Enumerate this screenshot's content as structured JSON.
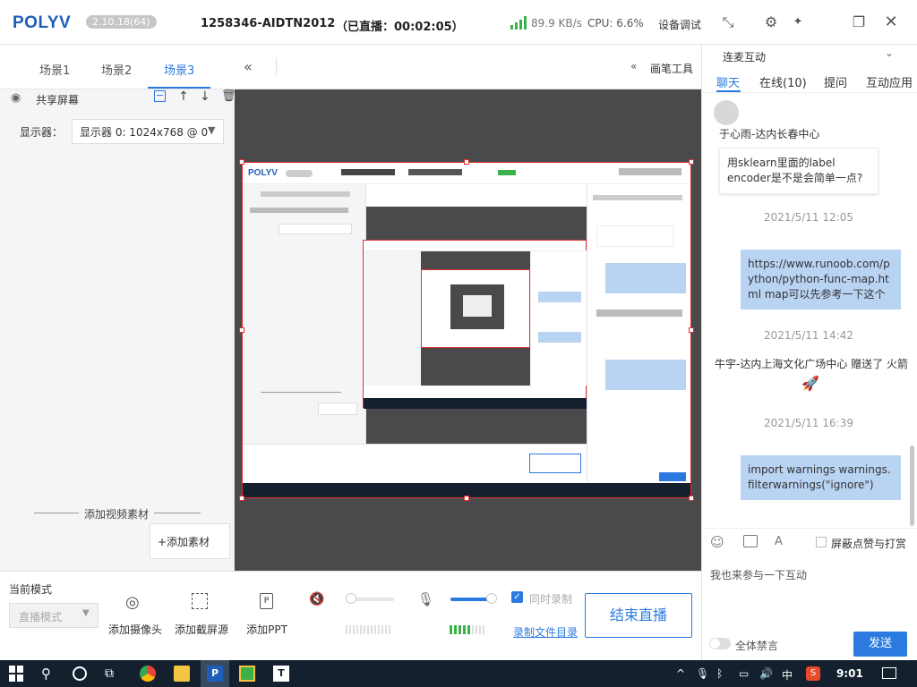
{
  "titlebar": {
    "logo": "POLYV",
    "version": "2.10.18(64)",
    "room_id": "1258346-AIDTN2012",
    "live_status": "（已直播：00:02:05）",
    "net_speed": "89.9 KB/s",
    "cpu": "CPU: 6.6%",
    "device_debug": "设备调试",
    "icons": [
      "collapse-icon",
      "gear-icon",
      "pin-icon",
      "restore-icon",
      "close-icon"
    ]
  },
  "scenes": {
    "tabs": [
      "场景1",
      "场景2",
      "场景3"
    ],
    "active": "场景3",
    "source_name": "共享屏幕",
    "display_label": "显示器：",
    "display_value": "显示器 0: 1024x768 @ 0",
    "add_video_label": "添加视频素材",
    "add_material_button": "+添加素材"
  },
  "stage": {
    "collapse_label": "«",
    "drawing_tool": "画笔工具"
  },
  "bottom": {
    "mode_label": "当前模式",
    "mode_value": "直播模式",
    "add_camera": "添加摄像头",
    "add_screen": "添加截屏源",
    "add_ppt": "添加PPT",
    "sync_record": "同时录制",
    "record_dir": "录制文件目录",
    "end_live": "结束直播"
  },
  "chat": {
    "header": "连麦互动",
    "tabs": [
      "聊天",
      "在线(10)",
      "提问",
      "互动应用"
    ],
    "active_tab": "聊天",
    "messages": {
      "m1_user": "于心雨-达内长春中心",
      "m1_text": "用sklearn里面的label encoder是不是会简单一点?",
      "t1": "2021/5/11 12:05",
      "m2_text": "https://www.runoob.com/python/python-func-map.html map可以先参考一下这个",
      "t2": "2021/5/11 14:42",
      "m3_text": "牛宇-达内上海文化广场中心 赠送了 火箭",
      "t3": "2021/5/11 16:39",
      "m4_text": "import warnings warnings.filterwarnings(\"ignore\")"
    },
    "block_label": "屏蔽点赞与打赏",
    "input_placeholder": "我也来参与一下互动",
    "mute_all": "全体禁言",
    "send_button": "发送"
  },
  "taskbar": {
    "time": "9:01",
    "ime": "中"
  },
  "colors": {
    "accent": "#2b7ae0",
    "stage_bg": "#4a4a4c",
    "bubble": "#b9d3f3",
    "taskbar": "#14202e",
    "signal": "#3bb14a"
  }
}
